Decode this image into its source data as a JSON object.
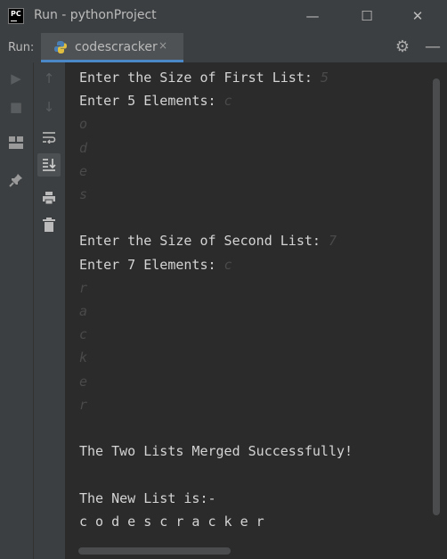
{
  "window": {
    "app_icon_text": "PC",
    "title": "Run - pythonProject",
    "minimize_glyph": "—",
    "maximize_glyph": "☐",
    "close_glyph": "✕"
  },
  "toolbar": {
    "run_label": "Run:",
    "tab_label": "codescracker",
    "tab_close": "×",
    "settings_icon": "gear-icon",
    "minimize_panel_icon": "minimize-icon"
  },
  "left_icons": [
    "run-icon",
    "stop-icon",
    "layout-icon",
    "pin-icon"
  ],
  "right_icons": [
    "up-arrow-icon",
    "down-arrow-icon",
    "soft-wrap-icon",
    "scroll-to-end-icon",
    "print-icon",
    "trash-icon"
  ],
  "console": {
    "lines": [
      {
        "text": "Enter the Size of First List: ",
        "input": "5"
      },
      {
        "text": "Enter 5 Elements: ",
        "input": "c"
      },
      {
        "text": "",
        "input": "o"
      },
      {
        "text": "",
        "input": "d"
      },
      {
        "text": "",
        "input": "e"
      },
      {
        "text": "",
        "input": "s"
      },
      {
        "text": "",
        "input": ""
      },
      {
        "text": "Enter the Size of Second List: ",
        "input": "7"
      },
      {
        "text": "Enter 7 Elements: ",
        "input": "c"
      },
      {
        "text": "",
        "input": "r"
      },
      {
        "text": "",
        "input": "a"
      },
      {
        "text": "",
        "input": "c"
      },
      {
        "text": "",
        "input": "k"
      },
      {
        "text": "",
        "input": "e"
      },
      {
        "text": "",
        "input": "r"
      },
      {
        "text": "",
        "input": ""
      },
      {
        "text": "The Two Lists Merged Successfully!",
        "input": ""
      },
      {
        "text": "",
        "input": ""
      },
      {
        "text": "The New List is:-",
        "input": ""
      },
      {
        "text": "c o d e s c r a c k e r",
        "input": ""
      }
    ]
  }
}
